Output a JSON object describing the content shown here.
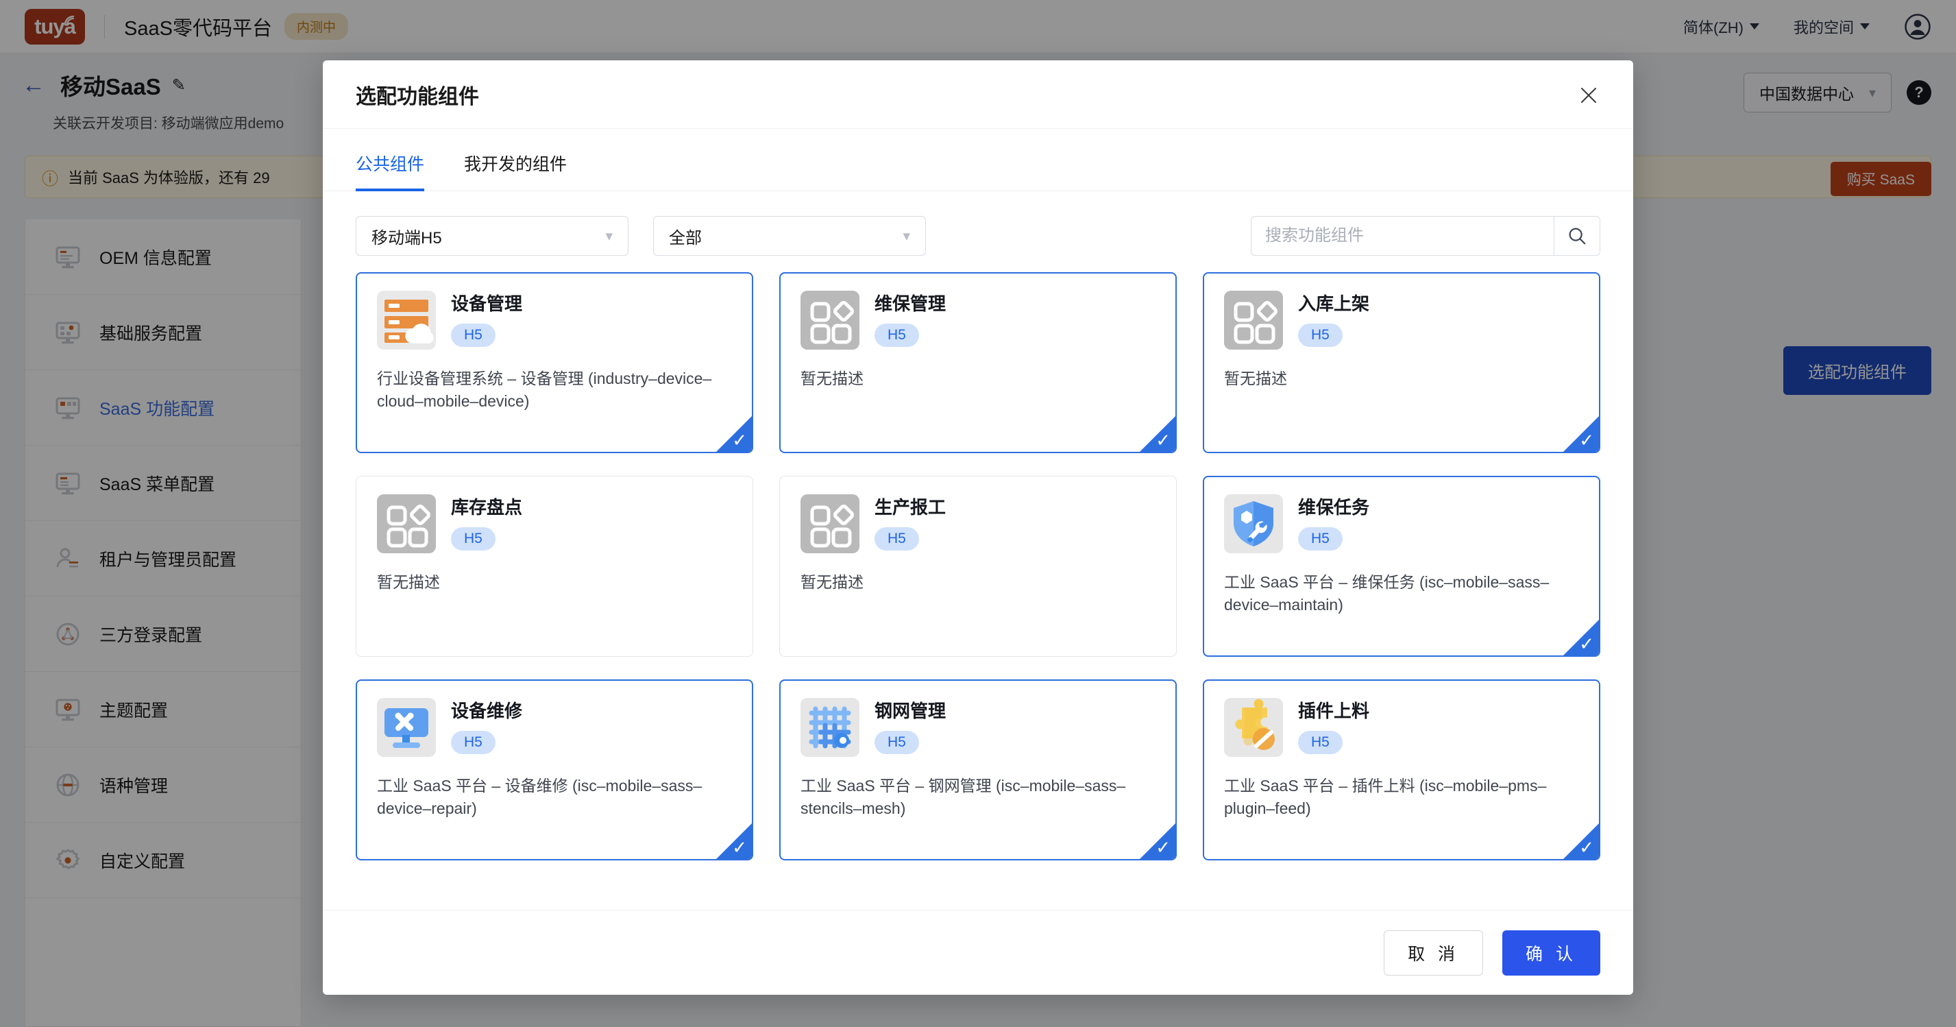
{
  "topbar": {
    "logo_text": "tuya",
    "logo_icon": "wifi-wave-icon",
    "product_title": "SaaS零代码平台",
    "beta_badge": "内测中",
    "language": "简体(ZH)",
    "workspace": "我的空间",
    "avatar_icon": "user-avatar-icon"
  },
  "subheader": {
    "back_icon": "back-arrow-icon",
    "project_title": "移动SaaS",
    "edit_icon": "pencil-icon",
    "subtitle": "关联云开发项目: 移动端微应用demo",
    "data_center": "中国数据中心",
    "help_icon": "question-mark-icon"
  },
  "alert": {
    "icon": "info-circle-icon",
    "text": "当前 SaaS 为体验版，还有 29",
    "buy_button": "购买 SaaS"
  },
  "sidebar": {
    "items": [
      {
        "label": "OEM 信息配置",
        "icon": "monitor-text-icon",
        "active": false
      },
      {
        "label": "基础服务配置",
        "icon": "monitor-dots-icon",
        "active": false
      },
      {
        "label": "SaaS 功能配置",
        "icon": "monitor-tiles-icon",
        "active": true
      },
      {
        "label": "SaaS 菜单配置",
        "icon": "monitor-menu-icon",
        "active": false
      },
      {
        "label": "租户与管理员配置",
        "icon": "user-lines-icon",
        "active": false
      },
      {
        "label": "三方登录配置",
        "icon": "share-nodes-icon",
        "active": false
      },
      {
        "label": "主题配置",
        "icon": "monitor-palette-icon",
        "active": false
      },
      {
        "label": "语种管理",
        "icon": "globe-icon",
        "active": false
      },
      {
        "label": "自定义配置",
        "icon": "gear-icon",
        "active": false
      }
    ]
  },
  "page_action": {
    "configure_button": "选配功能组件"
  },
  "modal": {
    "title": "选配功能组件",
    "close_icon": "close-icon",
    "tabs": [
      {
        "label": "公共组件",
        "active": true
      },
      {
        "label": "我开发的组件",
        "active": false
      }
    ],
    "filters": {
      "platform_value": "移动端H5",
      "category_value": "全部",
      "chevron_icon": "chevron-down-icon"
    },
    "search": {
      "placeholder": "搜索功能组件",
      "value": "",
      "icon": "search-icon"
    },
    "cards": [
      {
        "name": "设备管理",
        "tag": "H5",
        "desc": "行业设备管理系统 – 设备管理 (industry–device–cloud–mobile–device)",
        "icon": "server-cloud-icon",
        "selected": true
      },
      {
        "name": "维保管理",
        "tag": "H5",
        "desc": "暂无描述",
        "icon": "placeholder-blocks-icon",
        "selected": true
      },
      {
        "name": "入库上架",
        "tag": "H5",
        "desc": "暂无描述",
        "icon": "placeholder-blocks-icon",
        "selected": true
      },
      {
        "name": "库存盘点",
        "tag": "H5",
        "desc": "暂无描述",
        "icon": "placeholder-blocks-icon",
        "selected": false
      },
      {
        "name": "生产报工",
        "tag": "H5",
        "desc": "暂无描述",
        "icon": "placeholder-blocks-icon",
        "selected": false
      },
      {
        "name": "维保任务",
        "tag": "H5",
        "desc": "工业 SaaS 平台 – 维保任务 (isc–mobile–sass–device–maintain)",
        "icon": "shield-wrench-icon",
        "selected": true
      },
      {
        "name": "设备维修",
        "tag": "H5",
        "desc": "工业 SaaS 平台 – 设备维修 (isc–mobile–sass–device–repair)",
        "icon": "monitor-tools-icon",
        "selected": true
      },
      {
        "name": "钢网管理",
        "tag": "H5",
        "desc": "工业 SaaS 平台 – 钢网管理 (isc–mobile–sass–stencils–mesh)",
        "icon": "mesh-grid-icon",
        "selected": true
      },
      {
        "name": "插件上料",
        "tag": "H5",
        "desc": "工业 SaaS 平台 – 插件上料 (isc–mobile–pms–plugin–feed)",
        "icon": "puzzle-piece-icon",
        "selected": true
      }
    ],
    "footer": {
      "cancel": "取 消",
      "confirm": "确 认"
    }
  },
  "colors": {
    "brand_red": "#b03a1c",
    "primary_blue": "#2a54ea",
    "tab_blue": "#1a64e8",
    "select_blue": "#2e6fe0",
    "warn_orange": "#d46b08",
    "chip_bg": "#cfe0fb"
  }
}
